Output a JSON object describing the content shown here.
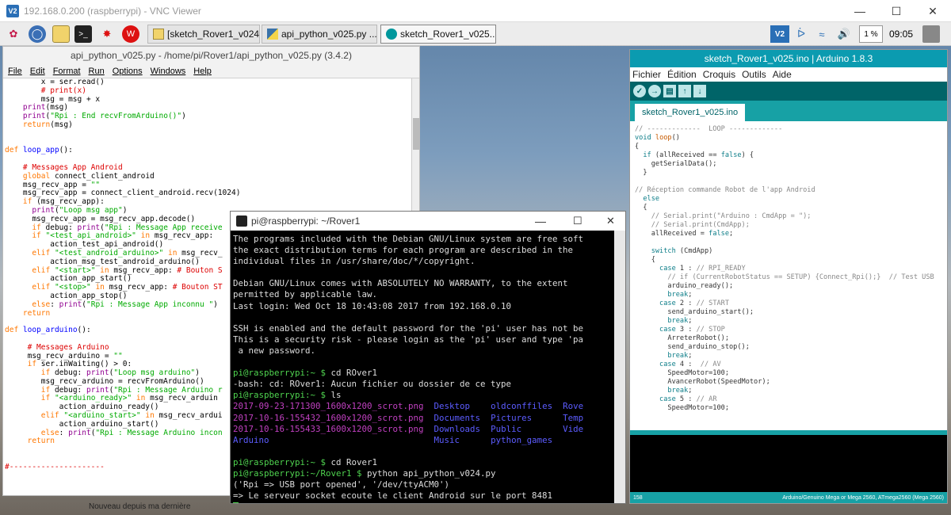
{
  "vnc": {
    "title": "192.168.0.200 (raspberrypi) - VNC Viewer",
    "logo": "V2"
  },
  "taskbar": {
    "tasks": [
      {
        "label": "[sketch_Rover1_v024..."
      },
      {
        "label": "api_python_v025.py ..."
      },
      {
        "label": "sketch_Rover1_v025..."
      }
    ],
    "launchers": [
      "raspberry-icon",
      "globe-icon",
      "folder-icon",
      "terminal-icon",
      "mathematica-icon",
      "wolfram-icon"
    ],
    "tray": {
      "vnc": "V2",
      "volume_pct": "1 %",
      "time": "09:05"
    }
  },
  "idle": {
    "title": "api_python_v025.py - /home/pi/Rover1/api_python_v025.py (3.4.2)",
    "menu": [
      "File",
      "Edit",
      "Format",
      "Run",
      "Options",
      "Windows",
      "Help"
    ]
  },
  "terminal": {
    "title": "pi@raspberrypi: ~/Rover1",
    "motd": [
      "The programs included with the Debian GNU/Linux system are free soft",
      "the exact distribution terms for each program are described in the",
      "individual files in /usr/share/doc/*/copyright.",
      "",
      "Debian GNU/Linux comes with ABSOLUTELY NO WARRANTY, to the extent",
      "permitted by applicable law.",
      "Last login: Wed Oct 18 10:43:08 2017 from 192.168.0.10",
      "",
      "SSH is enabled and the default password for the 'pi' user has not be",
      "This is a security risk - please login as the 'pi' user and type 'pa",
      " a new password.",
      ""
    ],
    "prompt": "pi@raspberrypi:~ $",
    "prompt_rover": "pi@raspberrypi:~/Rover1 $",
    "cmd1": " cd ROver1",
    "err1": "-bash: cd: ROver1: Aucun fichier ou dossier de ce type",
    "cmd2": " ls",
    "ls": [
      [
        "2017-09-23-171300_1600x1200_scrot.png",
        "Desktop",
        "oldconffiles",
        "Rove"
      ],
      [
        "2017-10-16-155432_1600x1200_scrot.png",
        "Documents",
        "Pictures",
        "Temp"
      ],
      [
        "2017-10-16-155433_1600x1200_scrot.png",
        "Downloads",
        "Public",
        "Vide"
      ],
      [
        "Arduino",
        "Music",
        "python_games"
      ]
    ],
    "cmd3": " cd Rover1",
    "cmd4": " python api_python_v024.py",
    "out1": "('Rpi => USB port opened', '/dev/ttyACM0')",
    "out2": "=> Le serveur socket ecoute le client Android sur le port 8481"
  },
  "arduino": {
    "title": "sketch_Rover1_v025.ino | Arduino 1.8.3",
    "menu": [
      "Fichier",
      "Édition",
      "Croquis",
      "Outils",
      "Aide"
    ],
    "tab": "sketch_Rover1_v025.ino",
    "status_line": "158",
    "board": "Arduino/Genuino Mega or Mega 2560, ATmega2560 (Mega 2560)"
  },
  "desktop": {
    "bottom_text": "Nouveau depuis ma dernière"
  }
}
